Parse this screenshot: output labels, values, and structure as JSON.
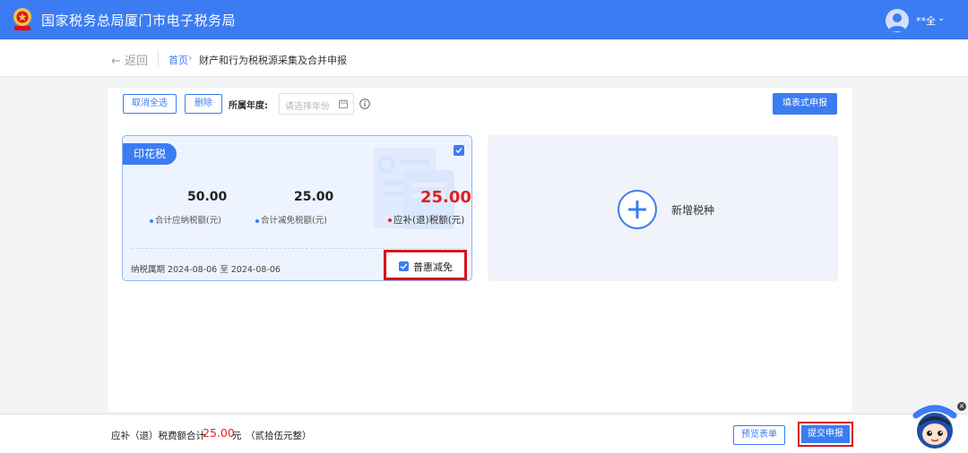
{
  "header": {
    "site_title": "国家税务总局厦门市电子税务局",
    "user_name": "**全",
    "user_caret": "⌄"
  },
  "breadcrumb": {
    "back_label": "← 返回",
    "home": "首页",
    "separator": "›",
    "current": "财产和行为税税源采集及合并申报"
  },
  "toolbar": {
    "cancel_all_label": "取消全选",
    "delete_label": "删除",
    "year_label": "所属年度:",
    "year_placeholder": "请选择年份",
    "fill_form_label": "填表式申报"
  },
  "tax_card": {
    "tax_type": "印花税",
    "checked": true,
    "total_payable_amount": "50.00",
    "total_payable_label": "合计应纳税额(元)",
    "total_relief_amount": "25.00",
    "total_relief_label": "合计减免税额(元)",
    "due_amount": "25.00",
    "due_label": "应补(退)税额(元)",
    "period": "纳税属期 2024-08-06 至 2024-08-06",
    "relief_label": "普惠减免",
    "relief_checked": true
  },
  "add_card": {
    "label": "新增税种"
  },
  "footer": {
    "sum_label": "应补（退）税费额合计",
    "sum_amount": "25.00",
    "sum_unit": "元",
    "sum_words": "（贰拾伍元整）",
    "preview_label": "预览表单",
    "submit_label": "提交申报"
  },
  "colors": {
    "primary": "#3b7cf2",
    "highlight_border": "#d9121f",
    "due_amount": "#e02020"
  }
}
